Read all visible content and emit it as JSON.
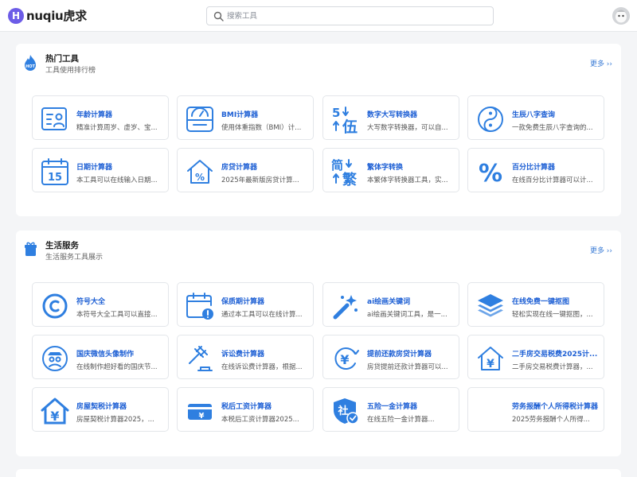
{
  "header": {
    "logo_letter": "H",
    "logo_text": "nuqiu虎求",
    "search_placeholder": "搜索工具"
  },
  "sections": [
    {
      "title": "热门工具",
      "subtitle": "工具使用排行榜",
      "more": "更多 ››",
      "badge": "HOT",
      "cards": [
        {
          "title": "年龄计算器",
          "desc": "精准计算周岁、虚岁、宝...",
          "icon": "id-card-icon"
        },
        {
          "title": "BMI计算器",
          "desc": "使用体重指数（BMI）计...",
          "icon": "scale-icon"
        },
        {
          "title": "数字大写转换器",
          "desc": "大写数字转换器，可以自...",
          "icon": "number-convert-icon",
          "glyph_top": "5",
          "glyph_bottom": "伍"
        },
        {
          "title": "生辰八字查询",
          "desc": "一款免费生辰八字查询的...",
          "icon": "yin-yang-icon"
        },
        {
          "title": "日期计算器",
          "desc": "本工具可以在线输入日期...",
          "icon": "calendar-icon",
          "glyph_top": "15"
        },
        {
          "title": "房贷计算器",
          "desc": "2025年最新版房贷计算...",
          "icon": "house-percent-icon",
          "glyph_top": "%"
        },
        {
          "title": "繁体字转换",
          "desc": "本繁体字转换器工具，实...",
          "icon": "traditional-convert-icon",
          "glyph_top": "简",
          "glyph_bottom": "繁"
        },
        {
          "title": "百分比计算器",
          "desc": "在线百分比计算器可以计...",
          "icon": "percent-icon",
          "glyph_top": "%"
        }
      ]
    },
    {
      "title": "生活服务",
      "subtitle": "生活服务工具展示",
      "more": "更多 ››",
      "cards": [
        {
          "title": "符号大全",
          "desc": "本符号大全工具可以直接...",
          "icon": "symbol-icon"
        },
        {
          "title": "保质期计算器",
          "desc": "通过本工具可以在线计算...",
          "icon": "calendar-alert-icon"
        },
        {
          "title": "ai绘画关键词",
          "desc": "ai绘画关键词工具，是一...",
          "icon": "magic-wand-icon"
        },
        {
          "title": "在线免费一键抠图",
          "desc": "轻松实现在线一键抠图，...",
          "icon": "layers-icon"
        },
        {
          "title": "国庆微信头像制作",
          "desc": "在线制作超好看的国庆节...",
          "icon": "avatar-badge-icon"
        },
        {
          "title": "诉讼费计算器",
          "desc": "在线诉讼费计算器，根据...",
          "icon": "gavel-icon"
        },
        {
          "title": "提前还款房贷计算器",
          "desc": "房贷提前还款计算器可以...",
          "icon": "yen-refresh-icon",
          "glyph_top": "¥"
        },
        {
          "title": "二手房交易税费2025计...",
          "desc": "二手房交易税费计算器，...",
          "icon": "house-yen-icon",
          "glyph_top": "¥"
        },
        {
          "title": "房屋契税计算器",
          "desc": "房屋契税计算器2025，...",
          "icon": "house-tax-icon",
          "glyph_top": "¥"
        },
        {
          "title": "税后工资计算器",
          "desc": "本税后工资计算器2025...",
          "icon": "wallet-yen-icon",
          "glyph_top": "¥"
        },
        {
          "title": "五险一金计算器",
          "desc": "在线五险一金计算器...",
          "icon": "shield-social-icon",
          "glyph_top": "社"
        },
        {
          "title": "劳务报酬个人所得税计算器",
          "desc": "2025劳务报酬个人所得...",
          "icon": ""
        }
      ]
    }
  ]
}
